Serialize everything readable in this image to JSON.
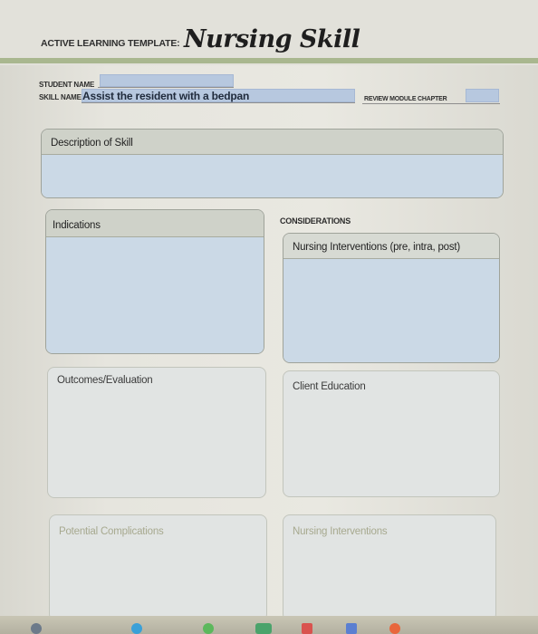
{
  "header": {
    "template_label": "ACTIVE LEARNING TEMPLATE:",
    "template_title": "Nursing Skill"
  },
  "fields": {
    "student_name_label": "STUDENT NAME",
    "student_name_value": "",
    "skill_name_label": "SKILL NAME",
    "skill_name_value": "Assist the resident with a bedpan",
    "review_module_label": "REVIEW MODULE CHAPTER",
    "review_module_value": ""
  },
  "sections": {
    "description": "Description of Skill",
    "indications": "Indications",
    "considerations": "CONSIDERATIONS",
    "nursing_interventions_ppp": "Nursing Interventions (pre, intra, post)",
    "outcomes": "Outcomes/Evaluation",
    "client_education": "Client Education",
    "potential_complications": "Potential Complications",
    "nursing_interventions": "Nursing Interventions"
  },
  "colors": {
    "header_rule": "#a9b78f",
    "field_fill": "#b7c8df",
    "panel_body": "#cbd9e6"
  }
}
